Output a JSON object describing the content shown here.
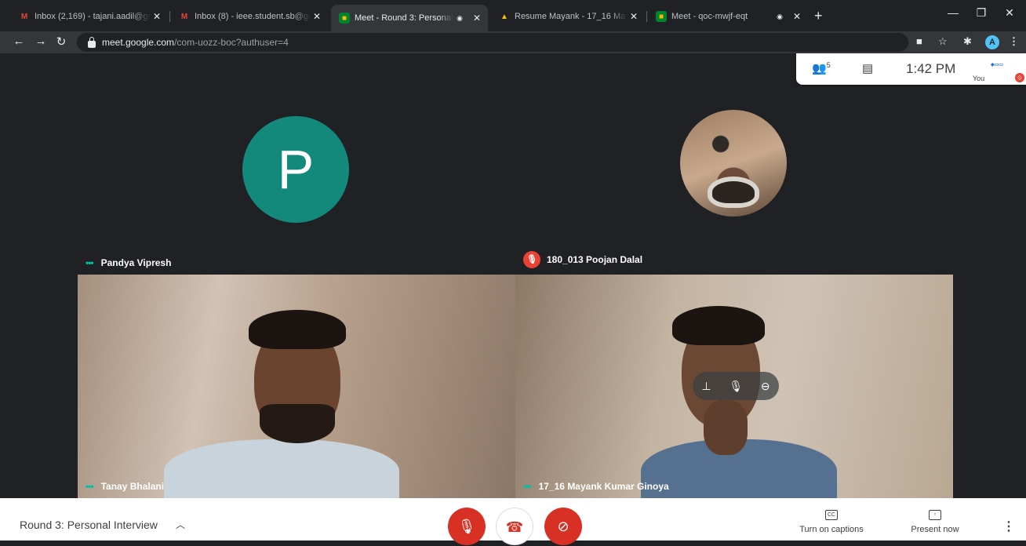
{
  "browser": {
    "tabs": [
      {
        "title": "Inbox (2,169) - tajani.aadil@gma",
        "icon": "gmail-icon"
      },
      {
        "title": "Inbox (8) - ieee.student.sb@gma",
        "icon": "gmail-icon"
      },
      {
        "title": "Meet - Round 3: Personal Int",
        "icon": "meet-icon",
        "active": true
      },
      {
        "title": "Resume Mayank - 17_16 Mayank",
        "icon": "drive-icon"
      },
      {
        "title": "Meet - qoc-mwjf-eqt",
        "icon": "meet-icon"
      }
    ],
    "url_host": "meet.google.com",
    "url_path": "/com-uozz-boc?authuser=4",
    "profile_initial": "A"
  },
  "meet": {
    "participants_count": "5",
    "clock": "1:42 PM",
    "self_label": "You",
    "tiles": [
      {
        "name": "Pandya Vipresh",
        "avatar_letter": "P",
        "audio": "speaking"
      },
      {
        "name": "180_013 Poojan Dalal",
        "audio": "muted"
      },
      {
        "name": "Tanay Bhalani",
        "audio": "speaking"
      },
      {
        "name": "17_16 Mayank Kumar Ginoya",
        "audio": "speaking"
      }
    ],
    "meeting_title": "Round 3: Personal Interview",
    "captions_label": "Turn on captions",
    "present_label": "Present now"
  },
  "colors": {
    "mute_red": "#d93025",
    "avatar_teal": "#12897a",
    "speaking_dots": "#00bfa5"
  }
}
